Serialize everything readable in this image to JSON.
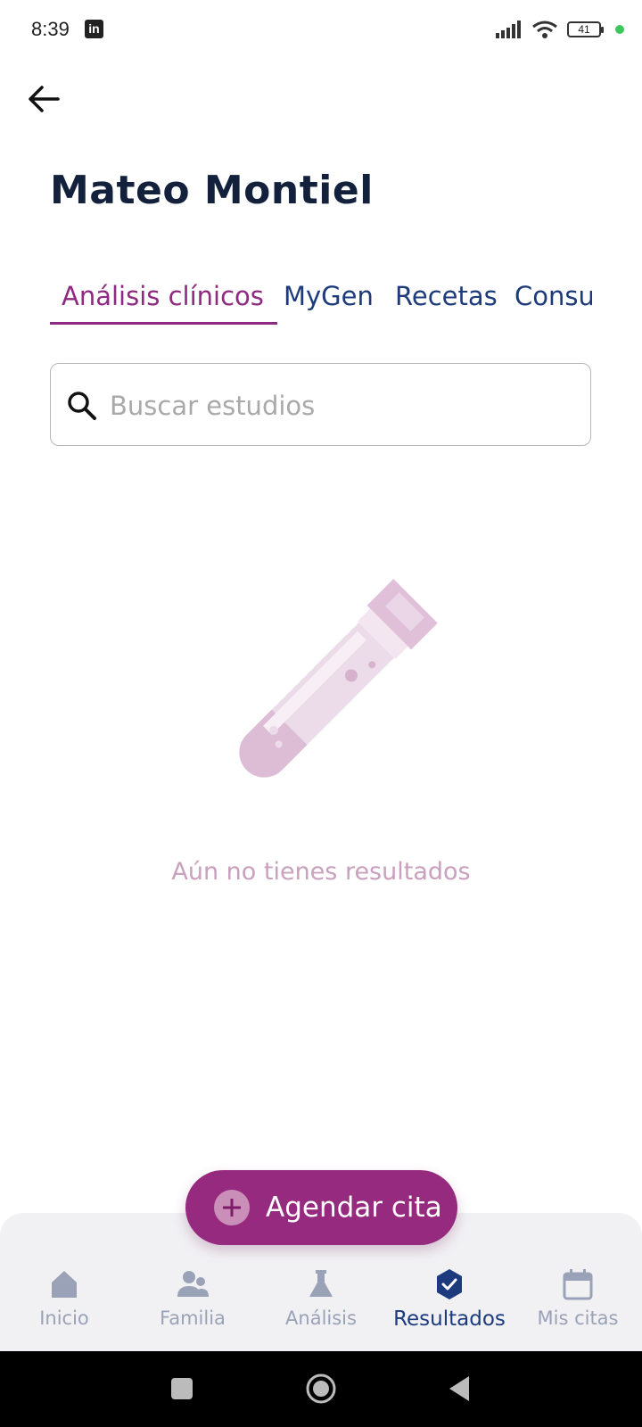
{
  "status_bar": {
    "time": "8:39",
    "notification_icon": "linkedin-icon",
    "battery": "41"
  },
  "header": {
    "back_icon": "arrow-left-icon",
    "title": "Mateo Montiel"
  },
  "tabs": [
    {
      "label": "Análisis clínicos",
      "active": true
    },
    {
      "label": "MyGen",
      "active": false
    },
    {
      "label": "Recetas",
      "active": false
    },
    {
      "label": "Consultas",
      "active": false
    }
  ],
  "search": {
    "placeholder": "Buscar estudios",
    "value": ""
  },
  "empty_state": {
    "illustration": "test-tube-icon",
    "message": "Aún no tienes resultados"
  },
  "fab": {
    "label": "Agendar cita",
    "icon": "plus-icon"
  },
  "bottom_nav": [
    {
      "label": "Inicio",
      "icon": "home-icon",
      "active": false
    },
    {
      "label": "Familia",
      "icon": "family-icon",
      "active": false
    },
    {
      "label": "Análisis",
      "icon": "flask-icon",
      "active": false
    },
    {
      "label": "Resultados",
      "icon": "badge-check-icon",
      "active": true
    },
    {
      "label": "Mis citas",
      "icon": "calendar-icon",
      "active": false
    }
  ],
  "colors": {
    "primary": "#952a7f",
    "navy": "#14213d",
    "nav_active": "#1c3a7d",
    "nav_inactive": "#9aa2b8",
    "empty_text": "#c9a0bd"
  }
}
